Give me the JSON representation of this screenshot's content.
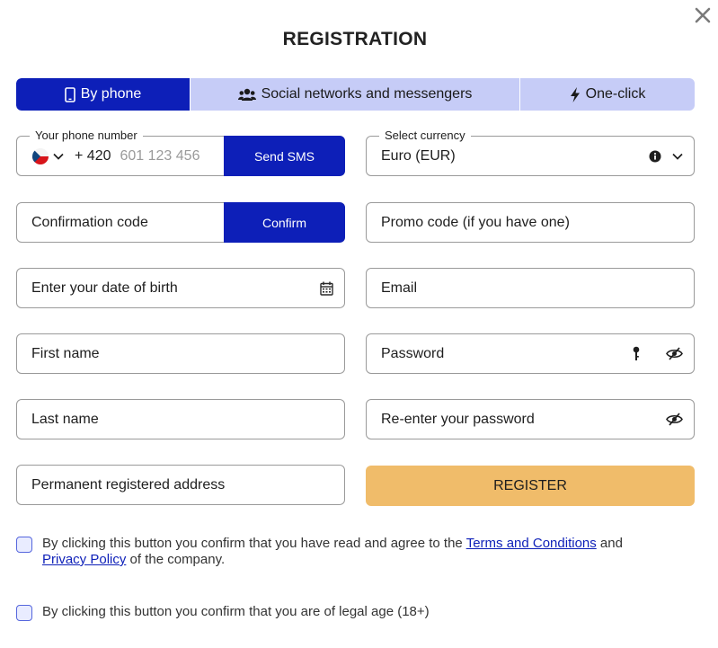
{
  "title": "REGISTRATION",
  "tabs": [
    {
      "label": "By phone",
      "icon": "smartphone-icon",
      "active": true
    },
    {
      "label": "Social networks and messengers",
      "icon": "users-icon"
    },
    {
      "label": "One-click",
      "icon": "lightning-icon"
    }
  ],
  "phone": {
    "legend": "Your phone number",
    "country_code": "+ 420",
    "placeholder": "601 123 456",
    "send_label": "Send SMS",
    "flag": "czech-flag-icon"
  },
  "currency": {
    "legend": "Select currency",
    "value": "Euro (EUR)"
  },
  "confirmation": {
    "placeholder": "Confirmation code",
    "confirm_label": "Confirm"
  },
  "promo": {
    "placeholder": "Promo code (if you have one)"
  },
  "birth": {
    "placeholder": "Enter your date of birth"
  },
  "email": {
    "placeholder": "Email"
  },
  "first_name": {
    "placeholder": "First name"
  },
  "password": {
    "placeholder": "Password"
  },
  "last_name": {
    "placeholder": "Last name"
  },
  "repassword": {
    "placeholder": "Re-enter your password"
  },
  "address": {
    "placeholder": "Permanent registered address"
  },
  "register_label": "REGISTER",
  "agree1": {
    "before": "By clicking this button you confirm that you have read and agree to the ",
    "terms": "Terms and Conditions",
    "middle": " and ",
    "privacy": "Privacy Policy",
    "after": " of the company."
  },
  "agree2": "By clicking this button you confirm that you are of legal age (18+)",
  "colors": {
    "primary": "#0d1fb8",
    "tab_bg": "#c6ccf7",
    "register": "#f0bc6a"
  }
}
